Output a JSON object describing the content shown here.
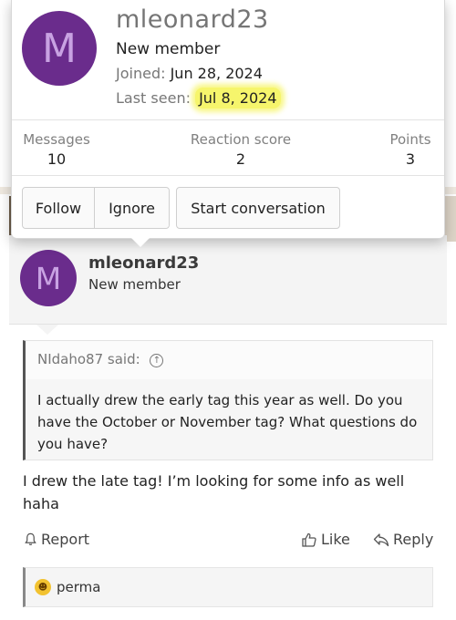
{
  "member_card": {
    "avatar_letter": "M",
    "username": "mleonard23",
    "user_title": "New member",
    "joined_label": "Joined:",
    "joined_value": "Jun 28, 2024",
    "last_seen_label": "Last seen:",
    "last_seen_value": "Jul 8, 2024",
    "stats": [
      {
        "label": "Messages",
        "value": "10"
      },
      {
        "label": "Reaction score",
        "value": "2"
      },
      {
        "label": "Points",
        "value": "3"
      }
    ],
    "buttons": {
      "follow": "Follow",
      "ignore": "Ignore",
      "start_conversation": "Start conversation"
    }
  },
  "post": {
    "avatar_letter": "M",
    "username": "mleonard23",
    "user_title": "New member",
    "quote": {
      "author_said": "NIdaho87 said:",
      "text": "I actually drew the early tag this year as well. Do you have the October or November tag? What questions do you have?"
    },
    "body": "I drew the late tag! I’m looking for some info as well haha",
    "actions": {
      "report": "Report",
      "like": "Like",
      "reply": "Reply"
    },
    "reactions": {
      "icon": "laughing-emoji-icon",
      "names": "perma"
    }
  },
  "colors": {
    "avatar_bg": "#6a2c8c",
    "highlight": "#f6f56c"
  }
}
